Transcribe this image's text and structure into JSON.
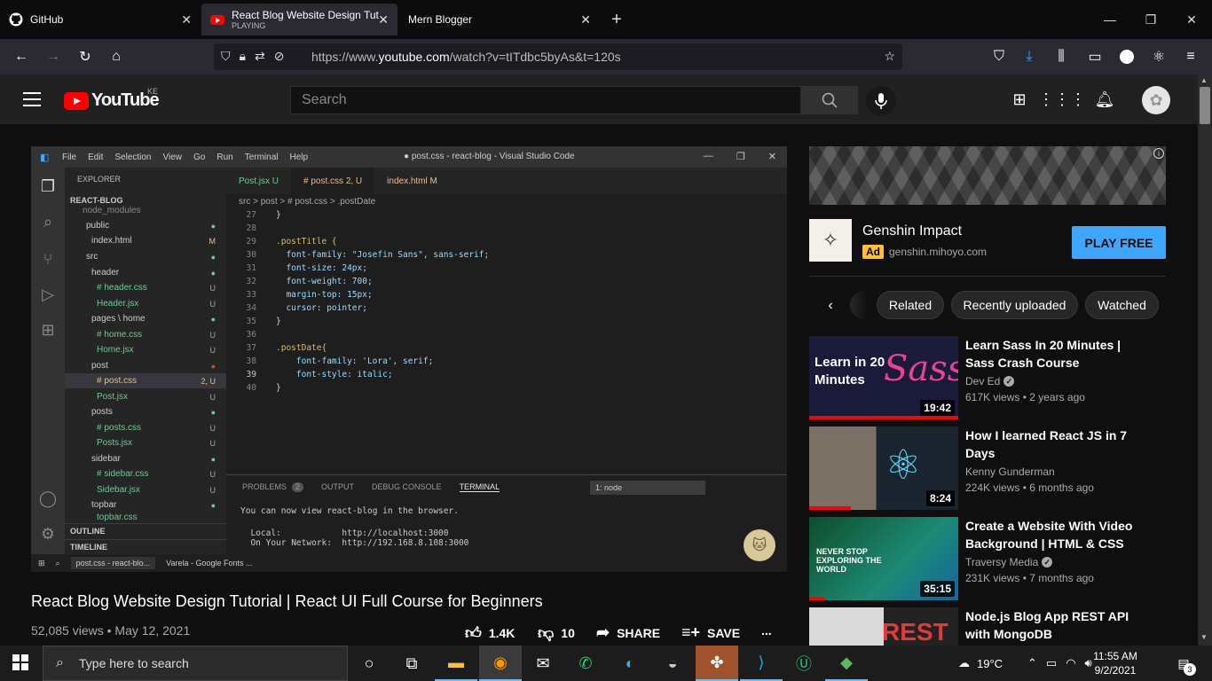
{
  "browser": {
    "tabs": [
      {
        "title": "GitHub",
        "sub": ""
      },
      {
        "title": "React Blog Website Design Tuto",
        "sub": "PLAYING"
      },
      {
        "title": "Mern Blogger",
        "sub": ""
      }
    ],
    "new_tab": "+",
    "url_prefix": "https://www.",
    "url_host": "youtube.com",
    "url_path": "/watch?v=tITdbc5byAs&t=120s"
  },
  "youtube": {
    "logo_text": "YouTube",
    "country": "KE",
    "search_placeholder": "Search"
  },
  "vscode": {
    "menu": [
      "File",
      "Edit",
      "Selection",
      "View",
      "Go",
      "Run",
      "Terminal",
      "Help"
    ],
    "window_title": "● post.css - react-blog - Visual Studio Code",
    "explorer_title": "EXPLORER",
    "project": "REACT-BLOG",
    "tree": [
      {
        "name": "node_modules",
        "status": ""
      },
      {
        "name": "public",
        "status": "●"
      },
      {
        "name": "index.html",
        "status": "M"
      },
      {
        "name": "src",
        "status": "●"
      },
      {
        "name": "header",
        "status": "●"
      },
      {
        "name": "# header.css",
        "status": "U"
      },
      {
        "name": "Header.jsx",
        "status": "U"
      },
      {
        "name": "pages \\ home",
        "status": "●"
      },
      {
        "name": "# home.css",
        "status": "U"
      },
      {
        "name": "Home.jsx",
        "status": "U"
      },
      {
        "name": "post",
        "status": "●"
      },
      {
        "name": "# post.css",
        "status": "2, U"
      },
      {
        "name": "Post.jsx",
        "status": "U"
      },
      {
        "name": "posts",
        "status": "●"
      },
      {
        "name": "# posts.css",
        "status": "U"
      },
      {
        "name": "Posts.jsx",
        "status": "U"
      },
      {
        "name": "sidebar",
        "status": "●"
      },
      {
        "name": "# sidebar.css",
        "status": "U"
      },
      {
        "name": "Sidebar.jsx",
        "status": "U"
      },
      {
        "name": "topbar",
        "status": "●"
      },
      {
        "name": "topbar.css",
        "status": "U"
      }
    ],
    "outline": "OUTLINE",
    "timeline": "TIMELINE",
    "tabs": [
      "Post.jsx  U",
      "#  post.css  2, U",
      "index.html  M"
    ],
    "breadcrumb": "src > post > # post.css > .postDate",
    "code": [
      {
        "n": "27",
        "t": "}"
      },
      {
        "n": "28",
        "t": ""
      },
      {
        "n": "29",
        "t": ".postTitle {"
      },
      {
        "n": "30",
        "t": "  font-family: \"Josefin Sans\", sans-serif;"
      },
      {
        "n": "31",
        "t": "  font-size: 24px;"
      },
      {
        "n": "32",
        "t": "  font-weight: 700;"
      },
      {
        "n": "33",
        "t": "  margin-top: 15px;"
      },
      {
        "n": "34",
        "t": "  cursor: pointer;"
      },
      {
        "n": "35",
        "t": "}"
      },
      {
        "n": "36",
        "t": ""
      },
      {
        "n": "37",
        "t": ".postDate{"
      },
      {
        "n": "38",
        "t": "    font-family: 'Lora', serif;"
      },
      {
        "n": "39",
        "t": "    font-style: italic;"
      },
      {
        "n": "40",
        "t": "}"
      }
    ],
    "panel_tabs": [
      "PROBLEMS",
      "2",
      "OUTPUT",
      "DEBUG CONSOLE",
      "TERMINAL"
    ],
    "terminal_select": "1: node",
    "terminal": [
      "You can now view react-blog in the browser.",
      "",
      "  Local:            http://localhost:3000",
      "  On Your Network:  http://192.168.8.108:3000"
    ],
    "statusbar": [
      "post.css - react-blo...",
      "Varela - Google Fonts ..."
    ]
  },
  "video": {
    "title": "React Blog Website Design Tutorial | React UI Full Course for Beginners",
    "views": "52,085 views",
    "date": "May 12, 2021",
    "likes": "1.4K",
    "dislikes": "10",
    "share": "SHARE",
    "save": "SAVE",
    "more": "..."
  },
  "ad": {
    "name": "Genshin Impact",
    "badge": "Ad",
    "domain": "genshin.mihoyo.com",
    "cta": "PLAY FREE"
  },
  "chips": [
    "Related",
    "Recently uploaded",
    "Watched"
  ],
  "related": [
    {
      "title": "Learn Sass In 20 Minutes | Sass Crash Course",
      "channel": "Dev Ed",
      "verified": true,
      "views": "617K views",
      "age": "2 years ago",
      "duration": "19:42",
      "thumb_text": "Learn in 20 Minutes",
      "thumb_logo": "Sass",
      "watched": 1.0
    },
    {
      "title": "How I learned React JS in 7 Days",
      "channel": "Kenny Gunderman",
      "verified": false,
      "views": "224K views",
      "age": "6 months ago",
      "duration": "8:24",
      "watched": 0.28
    },
    {
      "title": "Create a Website With Video Background | HTML & CSS",
      "channel": "Traversy Media",
      "verified": true,
      "views": "231K views",
      "age": "7 months ago",
      "duration": "35:15",
      "thumb_text": "NEVER STOP EXPLORING THE WORLD",
      "watched": 0.1
    },
    {
      "title": "Node.js Blog App REST API with MongoDB",
      "channel": "",
      "verified": false,
      "views": "",
      "age": "",
      "duration": "",
      "thumb_logo": "REST",
      "watched": 0
    }
  ],
  "taskbar": {
    "search_placeholder": "Type here to search",
    "weather": "19°C",
    "time": "11:55 AM",
    "date": "9/2/2021",
    "notifications": "3"
  }
}
